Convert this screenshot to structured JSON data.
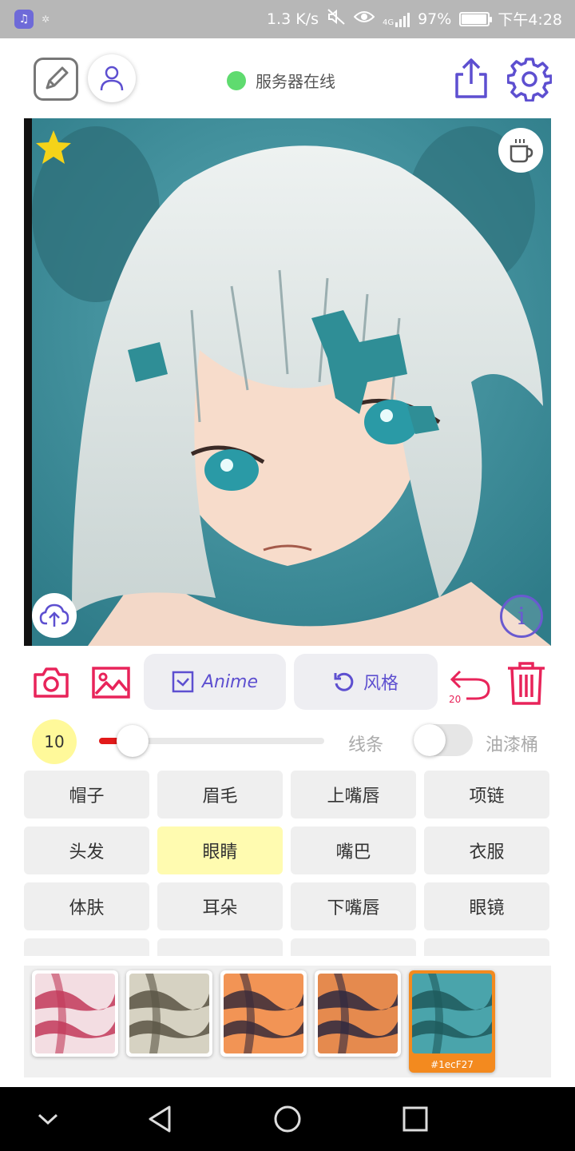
{
  "status_bar": {
    "net_speed": "1.3 K/s",
    "network": "4G",
    "battery": "97%",
    "battery_level": 0.97,
    "time": "下午4:28"
  },
  "header": {
    "server_status": "服务器在线",
    "server_color": "#5fdb6f"
  },
  "toolbar": {
    "anime_label": "Anime",
    "style_label": "风格",
    "undo_count": "20",
    "accent_color": "#5d4fd0",
    "danger_color": "#e8245a"
  },
  "brush": {
    "size": "10",
    "slider_value": 0.15,
    "line_label": "线条",
    "bucket_label": "油漆桶",
    "bucket_enabled": false
  },
  "labels": {
    "items": [
      {
        "text": "帽子",
        "active": false
      },
      {
        "text": "眉毛",
        "active": false
      },
      {
        "text": "上嘴唇",
        "active": false
      },
      {
        "text": "项链",
        "active": false
      },
      {
        "text": "头发",
        "active": false
      },
      {
        "text": "眼睛",
        "active": true
      },
      {
        "text": "嘴巴",
        "active": false
      },
      {
        "text": "衣服",
        "active": false
      },
      {
        "text": "体肤",
        "active": false
      },
      {
        "text": "耳朵",
        "active": false
      },
      {
        "text": "下嘴唇",
        "active": false
      },
      {
        "text": "眼镜",
        "active": false
      },
      {
        "text": "",
        "active": false
      },
      {
        "text": "",
        "active": false
      },
      {
        "text": "",
        "active": false
      },
      {
        "text": "",
        "active": false
      }
    ]
  },
  "textures": {
    "items": [
      {
        "color": "#c23a5a",
        "base": "#f3dde2",
        "selected": false,
        "label": ""
      },
      {
        "color": "#5a5544",
        "base": "#d6d2c2",
        "selected": false,
        "label": ""
      },
      {
        "color": "#3a2c3a",
        "base": "#f29455",
        "selected": false,
        "label": ""
      },
      {
        "color": "#2e2840",
        "base": "#e58a4e",
        "selected": false,
        "label": ""
      },
      {
        "color": "#1e5a5c",
        "base": "#4aa4ab",
        "selected": true,
        "label": "#1ecF27"
      }
    ],
    "selected_color": "#f38a1f"
  }
}
